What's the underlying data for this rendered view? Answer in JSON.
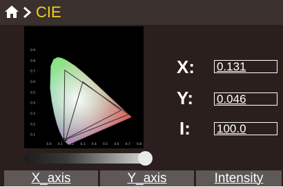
{
  "header": {
    "title": "CIE"
  },
  "chart_data": {
    "type": "scatter",
    "title": "",
    "xlabel": "",
    "ylabel": "",
    "x_ticks": [
      "0.0",
      "0.1",
      "0.2",
      "0.3",
      "0.4",
      "0.5",
      "0.6",
      "0.7",
      "0.8"
    ],
    "y_ticks": [
      "0.9",
      "0.8",
      "0.7",
      "0.6",
      "0.5",
      "0.4",
      "0.3",
      "0.2",
      "0.1"
    ],
    "xlim": [
      0,
      0.8
    ],
    "ylim": [
      0,
      0.9
    ],
    "grid": false,
    "series": [
      {
        "values": [
          [
            0.131,
            0.046
          ]
        ]
      }
    ]
  },
  "readouts": {
    "x": {
      "label": "X:",
      "value": "0.131"
    },
    "y": {
      "label": "Y:",
      "value": "0.046"
    },
    "i": {
      "label": "I:",
      "value": "100.0"
    }
  },
  "slider": {
    "level": 1.0
  },
  "tabs": [
    {
      "label": "X_axis"
    },
    {
      "label": "Y_axis"
    },
    {
      "label": "Intensity"
    }
  ],
  "colors": {
    "title": "#f2d21c",
    "background": "#2b1f1e",
    "header": "#3a302e",
    "tab": "#5e5857"
  },
  "icons": {
    "home": "home-icon",
    "chevron": "chevron-right-icon"
  }
}
